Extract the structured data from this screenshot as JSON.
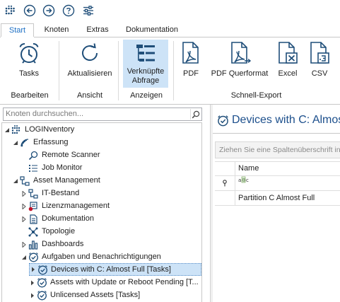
{
  "quick_access": [
    {
      "icon": "app-menu-icon"
    },
    {
      "icon": "back-icon"
    },
    {
      "icon": "forward-icon"
    },
    {
      "icon": "help-icon"
    },
    {
      "icon": "settings-sliders-icon"
    }
  ],
  "tabs": [
    {
      "label": "Start",
      "active": true
    },
    {
      "label": "Knoten",
      "active": false
    },
    {
      "label": "Extras",
      "active": false
    },
    {
      "label": "Dokumentation",
      "active": false
    }
  ],
  "ribbon": {
    "buttons": {
      "tasks": {
        "label": "Tasks",
        "icon": "alarm-clock-icon"
      },
      "refresh": {
        "label": "Aktualisieren",
        "icon": "refresh-icon"
      },
      "linked": {
        "label_line1": "Verknüpfte",
        "label_line2": "Abfrage",
        "icon": "linked-query-icon",
        "selected": true
      },
      "pdf": {
        "label": "PDF",
        "icon": "pdf-icon"
      },
      "pdf_landscape": {
        "label": "PDF Querformat",
        "icon": "pdf-landscape-icon"
      },
      "excel": {
        "label": "Excel",
        "icon": "excel-icon"
      },
      "csv": {
        "label": "CSV",
        "icon": "csv-icon"
      }
    },
    "groups": {
      "bearbeiten": "Bearbeiten",
      "ansicht": "Ansicht",
      "anzeigen": "Anzeigen",
      "export": "Schnell-Export"
    }
  },
  "tree": {
    "search_placeholder": "Knoten durchsuchen...",
    "nodes": [
      {
        "label": "LOGINventory",
        "icon": "logo-icon"
      },
      {
        "label": "Erfassung",
        "icon": "wifi-scan-icon"
      },
      {
        "label": "Remote Scanner",
        "icon": "magnifier-icon"
      },
      {
        "label": "Job Monitor",
        "icon": "list-icon"
      },
      {
        "label": "Asset Management",
        "icon": "hierarchy-icon"
      },
      {
        "label": "IT-Bestand",
        "icon": "hierarchy-icon"
      },
      {
        "label": "Lizenzmanagement",
        "icon": "license-icon"
      },
      {
        "label": "Dokumentation",
        "icon": "document-icon"
      },
      {
        "label": "Topologie",
        "icon": "topology-icon"
      },
      {
        "label": "Dashboards",
        "icon": "bar-chart-icon"
      },
      {
        "label": "Aufgaben und Benachrichtigungen",
        "icon": "task-check-icon"
      },
      {
        "label": "Devices with C: Almost Full [Tasks]",
        "icon": "task-check-icon",
        "selected": true
      },
      {
        "label": "Assets with Update or Reboot Pending [T...",
        "icon": "task-check-icon"
      },
      {
        "label": "Unlicensed Assets [Tasks]",
        "icon": "task-check-icon"
      }
    ]
  },
  "content": {
    "title": "Devices with C: Almos",
    "group_hint": "Ziehen Sie eine Spaltenüberschrift in",
    "columns": [
      "Name"
    ],
    "filter_value": "",
    "rows": [
      {
        "name": "Partition C Almost Full"
      }
    ]
  },
  "colors": {
    "accent": "#1c6fc4",
    "selection": "#cde3f7",
    "icon_blue": "#1f4e79",
    "title_blue": "#1c4f8c"
  }
}
